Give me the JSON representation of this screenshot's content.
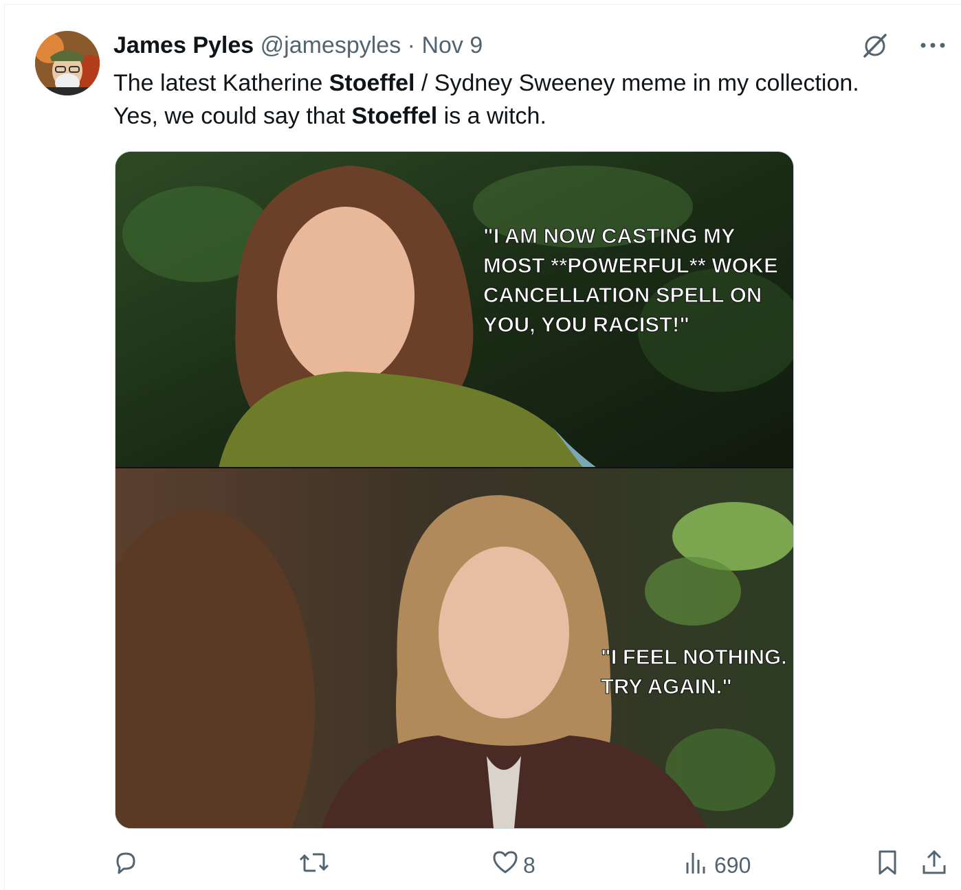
{
  "tweet": {
    "author_name": "James Pyles",
    "author_handle": "@jamespyles",
    "separator": "·",
    "date": "Nov 9",
    "text_line1": [
      {
        "t": "The latest Katherine ",
        "b": false
      },
      {
        "t": "Stoeffel",
        "b": true
      },
      {
        "t": " / Sydney Sweeney meme in my collection.",
        "b": false
      }
    ],
    "text_line2": [
      {
        "t": "Yes, we could say that ",
        "b": false
      },
      {
        "t": "Stoeffel",
        "b": true
      },
      {
        "t": " is a witch.",
        "b": false
      }
    ]
  },
  "meme": {
    "top_caption": [
      "\"I AM NOW CASTING MY",
      "MOST **POWERFUL** WOKE",
      "CANCELLATION SPELL ON",
      "YOU, YOU RACIST!\""
    ],
    "bottom_caption": [
      "\"I FEEL NOTHING.",
      "TRY AGAIN.\""
    ]
  },
  "actions": {
    "reply_count": "",
    "repost_count": "",
    "like_count": "8",
    "views_count": "690"
  },
  "icons": {
    "grok": "grok-icon",
    "more": "more-icon",
    "reply": "reply-icon",
    "repost": "repost-icon",
    "like": "heart-icon",
    "views": "views-icon",
    "bookmark": "bookmark-icon",
    "share": "share-icon"
  }
}
